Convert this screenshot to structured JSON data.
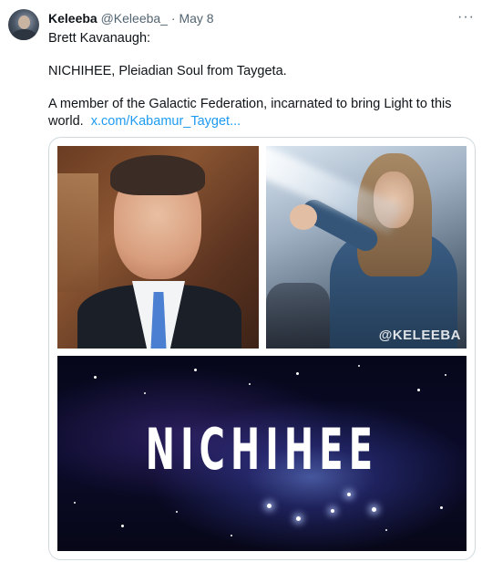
{
  "tweet": {
    "author_name": "Keleeba",
    "handle": "@Keleeba_",
    "separator": "·",
    "date": "May 8",
    "more_label": "···",
    "line1": "Brett Kavanaugh:",
    "line2": "NICHIHEE, Pleiadian Soul from Taygeta.",
    "line3": "A member of the Galactic Federation, incarnated to bring Light to this world.",
    "link": "x.com/Kabamur_Tayget..."
  },
  "media": {
    "watermark": "@KELEEBA",
    "title": "NICHIHEE"
  }
}
